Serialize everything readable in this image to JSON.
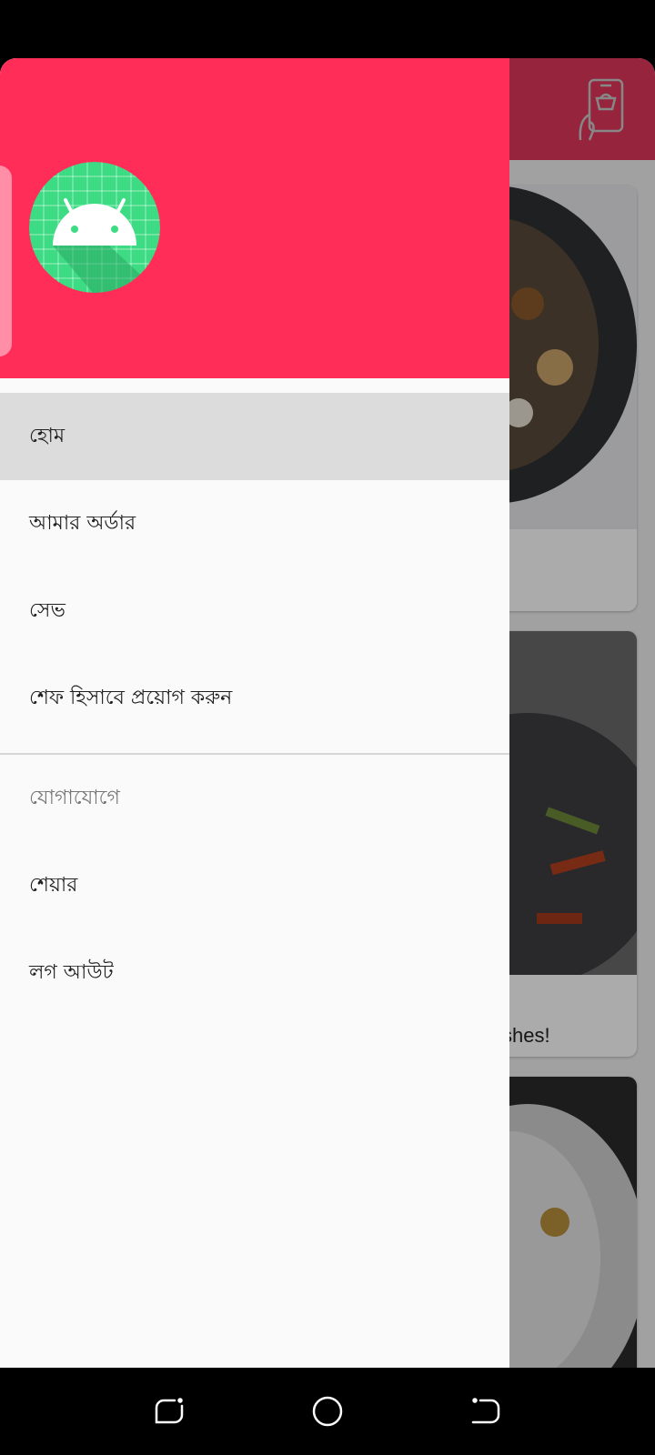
{
  "background_app": {
    "card2_caption": "shes!"
  },
  "drawer": {
    "menu_items": [
      {
        "label": "হোম",
        "active": true
      },
      {
        "label": "আমার অর্ডার",
        "active": false
      },
      {
        "label": "সেভ",
        "active": false
      },
      {
        "label": "শেফ হিসাবে প্রয়োগ করুন",
        "active": false
      }
    ],
    "section_title": "যোগাযোগে",
    "section_items": [
      {
        "label": "শেয়ার"
      },
      {
        "label": "লগ আউট"
      }
    ]
  },
  "icons": {
    "avatar": "android-icon",
    "toolbar": "mobile-shopping-icon",
    "nav_back": "back-icon",
    "nav_home": "home-circle-icon",
    "nav_recents": "recents-icon"
  },
  "colors": {
    "drawer_header": "#ff2d58",
    "toolbar": "#e0365c",
    "active_item": "#dcdcdc",
    "android_green": "#3ddc84"
  }
}
